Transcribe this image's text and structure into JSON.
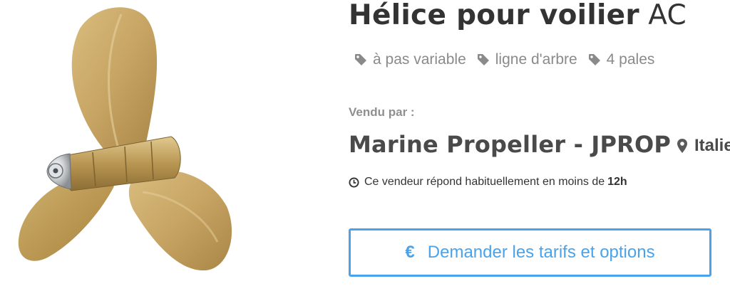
{
  "product": {
    "title_bold": "Hélice pour voilier",
    "title_light": "AC",
    "tags": [
      {
        "icon": "tag-icon",
        "label": "à pas variable"
      },
      {
        "icon": "tag-icon",
        "label": "ligne d'arbre"
      },
      {
        "icon": "tag-icon",
        "label": "4 pales"
      }
    ],
    "image_icon": "propeller-image"
  },
  "seller": {
    "sold_by_label": "Vendu par :",
    "name": "Marine Propeller - JPROP",
    "location": "Italie",
    "location_icon": "map-pin-icon",
    "response_text": "Ce vendeur répond habituellement en moins de",
    "response_hours": "12h",
    "response_icon": "clock-icon"
  },
  "cta": {
    "icon": "€",
    "label": "Demander les tarifs et options"
  },
  "colors": {
    "accent": "#4aa3ea",
    "text": "#333333",
    "muted": "#8a8a8a",
    "bronze": "#c9a766"
  }
}
